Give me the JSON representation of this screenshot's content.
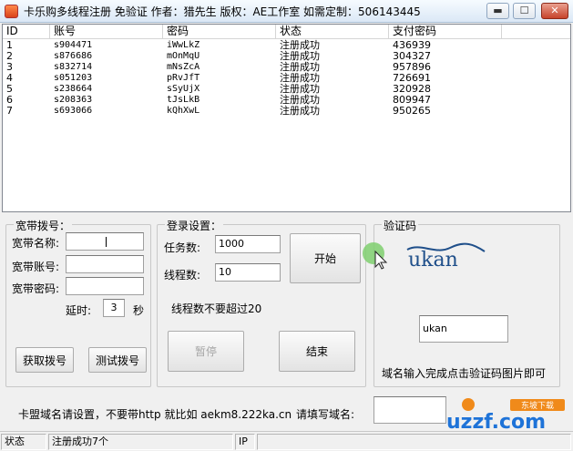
{
  "window": {
    "title": "卡乐购多线程注册 免验证 作者：猎先生 版权：AE工作室 如需定制：506143445",
    "minimize": "▬",
    "maximize": "☐",
    "close": "✕"
  },
  "table": {
    "columns": [
      "ID",
      "账号",
      "密码",
      "状态",
      "支付密码"
    ],
    "rows": [
      [
        "1",
        "s904471",
        "iWwLkZ",
        "注册成功",
        "436939"
      ],
      [
        "2",
        "s876686",
        "mOnMqU",
        "注册成功",
        "304327"
      ],
      [
        "3",
        "s832714",
        "mNsZcA",
        "注册成功",
        "957896"
      ],
      [
        "4",
        "s051203",
        "pRvJfT",
        "注册成功",
        "726691"
      ],
      [
        "5",
        "s238664",
        "sSyUjX",
        "注册成功",
        "320928"
      ],
      [
        "6",
        "s208363",
        "tJsLkB",
        "注册成功",
        "809947"
      ],
      [
        "7",
        "s693066",
        "kQhXwL",
        "注册成功",
        "950265"
      ]
    ]
  },
  "dial": {
    "group_title": "宽带拨号：",
    "name_label": "宽带名称:",
    "account_label": "宽带账号:",
    "password_label": "宽带密码:",
    "delay_label": "延时:",
    "delay_value": "3",
    "delay_unit": "秒",
    "get_button": "获取拨号",
    "test_button": "测试拨号"
  },
  "login": {
    "group_title": "登录设置：",
    "tasks_label": "任务数:",
    "tasks_value": "1000",
    "threads_label": "线程数:",
    "threads_value": "10",
    "thread_hint": "线程数不要超过20",
    "start_button": "开始",
    "pause_button": "暂停",
    "end_button": "结束"
  },
  "captcha": {
    "group_title": "验证码",
    "image_text": "ukan",
    "input_value": "ukan",
    "hint": "域名输入完成点击验证码图片即可"
  },
  "domain_bar": {
    "text": "卡盟域名请设置，不要带http 就比如 aekm8.222ka.cn",
    "prompt": "请填写域名:"
  },
  "watermark": {
    "text": "uzzf.com",
    "tag": "东坡下载"
  },
  "statusbar": {
    "label": "状态",
    "message": "注册成功7个",
    "ip_label": "IP"
  },
  "colors": {
    "captcha_blue": "#1f4f8a",
    "watermark_blue": "#1e73d8",
    "watermark_orange": "#f08a1a"
  }
}
